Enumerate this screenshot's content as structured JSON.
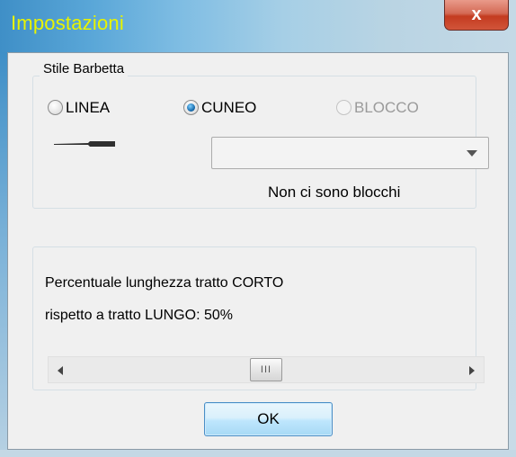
{
  "window": {
    "title": "Impostazioni",
    "close_glyph": "x"
  },
  "style_group": {
    "label": "Stile Barbetta",
    "options": [
      {
        "label": "LINEA",
        "checked": false,
        "enabled": true
      },
      {
        "label": "CUNEO",
        "checked": true,
        "enabled": true
      },
      {
        "label": "BLOCCO",
        "checked": false,
        "enabled": false
      }
    ],
    "block_combo_value": "",
    "no_blocks_text": "Non ci sono blocchi"
  },
  "percent_panel": {
    "line1": "Percentuale lunghezza tratto CORTO",
    "line2": "rispetto a tratto LUNGO: 50%",
    "value_percent": 50,
    "thumb_grip": "III"
  },
  "buttons": {
    "ok_label": "OK"
  },
  "colors": {
    "title_text": "#e8f400",
    "close_button": "#c43b20",
    "dialog_background": "#f0f0f0",
    "ok_border": "#4a8ec6"
  },
  "icons": {
    "close": "close-icon",
    "dropdown": "chevron-down-icon",
    "scroll_left": "arrow-left-icon",
    "scroll_right": "arrow-right-icon"
  }
}
